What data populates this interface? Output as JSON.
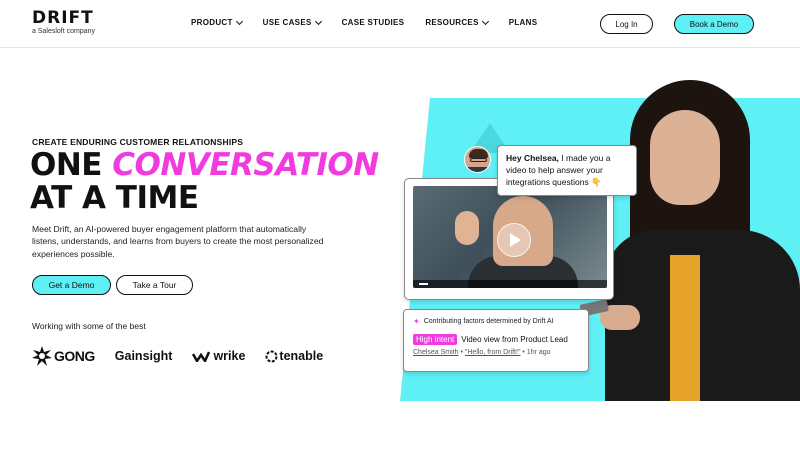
{
  "header": {
    "logo_text": "DRIFT",
    "logo_sub": "a Salesloft company",
    "nav": [
      {
        "label": "PRODUCT",
        "dropdown": true
      },
      {
        "label": "USE CASES",
        "dropdown": true
      },
      {
        "label": "CASE STUDIES",
        "dropdown": false
      },
      {
        "label": "RESOURCES",
        "dropdown": true
      },
      {
        "label": "PLANS",
        "dropdown": false
      }
    ],
    "login_label": "Log In",
    "book_demo_label": "Book a Demo"
  },
  "hero": {
    "eyebrow": "CREATE ENDURING CUSTOMER RELATIONSHIPS",
    "headline_part1": "ONE",
    "headline_highlight": "CONVERSATION",
    "headline_part2": "AT A TIME",
    "description": "Meet Drift, an AI-powered buyer engagement platform that automatically listens, understands, and learns from buyers to create the most personalized experiences possible.",
    "primary_cta": "Get a Demo",
    "secondary_cta": "Take a Tour",
    "working_with": "Working with some of the best",
    "customer_logos": [
      "GONG",
      "Gainsight",
      "wrike",
      "tenable"
    ]
  },
  "chat": {
    "greeting_bold": "Hey Chelsea,",
    "greeting_rest": " I made you a video to help answer your integrations questions 👇"
  },
  "video": {
    "progress": 0.05
  },
  "intent": {
    "title": "Contributing factors determined by Drift AI",
    "badge": "High intent",
    "event": "Video view from Product Lead",
    "person": "Chelsea Smith",
    "bullet1": "•",
    "quote": "\"Hello, from Drift!\"",
    "bullet2": "•",
    "time": "1hr ago"
  },
  "colors": {
    "accent_cyan": "#5ef0f5",
    "accent_pink": "#f13be0"
  }
}
